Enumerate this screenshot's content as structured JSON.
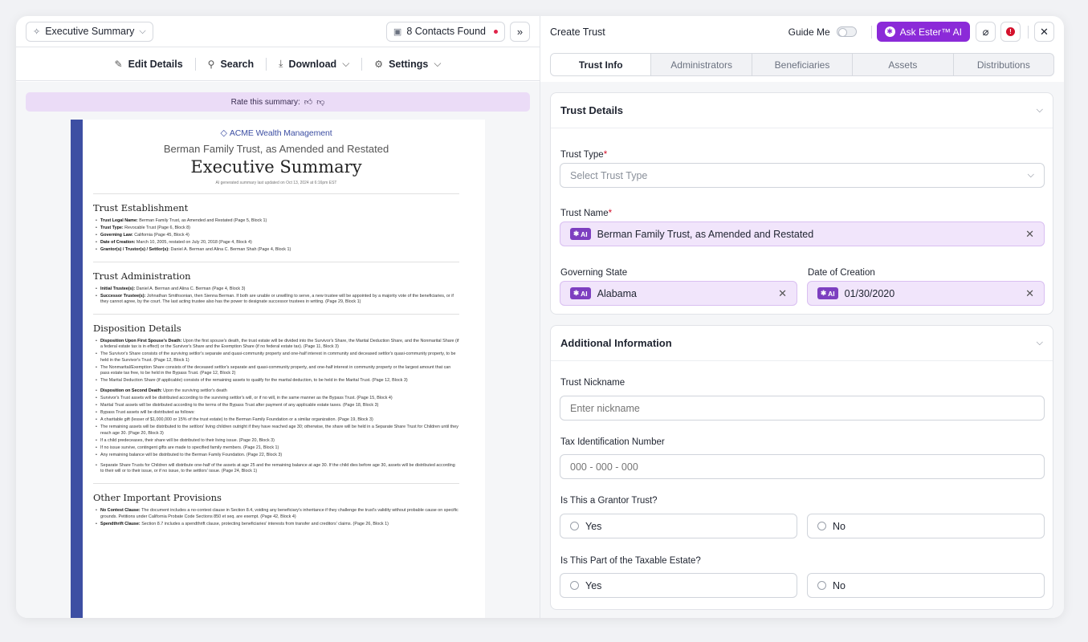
{
  "left": {
    "summary_selector": "Executive Summary",
    "contacts_found": "8 Contacts Found",
    "toolbar": {
      "edit": "Edit Details",
      "search": "Search",
      "download": "Download",
      "settings": "Settings"
    },
    "rate_text": "Rate this summary:",
    "document": {
      "brand": "ACME Wealth Management",
      "subtitle": "Berman Family Trust, as Amended and Restated",
      "title": "Executive Summary",
      "updated": "AI generated summary last updated on Oct 13, 2024 at 6:16pm EST",
      "sections": [
        {
          "heading": "Trust Establishment",
          "bullets": [
            {
              "bold": "Trust Legal Name:",
              "text": " Berman Family Trust, as Amended and Restated (Page 5, Block 1)"
            },
            {
              "bold": "Trust Type:",
              "text": " Revocable Trust (Page 6, Block 8)"
            },
            {
              "bold": "Governing Law:",
              "text": " California (Page 45, Block 4)"
            },
            {
              "bold": "Date of Creation:",
              "text": " March 10, 2005, restated on July 20, 2018 (Page 4, Block 4)"
            },
            {
              "bold": "Grantor(s) / Trustor(s) / Settlor(s):",
              "text": " Daniel A. Berman and Alina C. Berman Shah (Page 4, Block 1)"
            }
          ]
        },
        {
          "heading": "Trust Administration",
          "bullets": [
            {
              "bold": "Initial Trustee(s):",
              "text": " Daniel A. Berman and Alina C. Berman (Page 4, Block 3)"
            },
            {
              "bold": "Successor Trustee(s):",
              "text": " Johnathan Smithsonian, then Sienna Berman. If both are unable or unwilling to serve, a new trustee will be appointed by a majority vote of the beneficiaries, or if they cannot agree, by the court. The last acting trustee also has the power to designate successor trustees in writing. (Page 29, Block 1)"
            }
          ]
        },
        {
          "heading": "Disposition Details",
          "bullets": [
            {
              "bold": "Disposition Upon First Spouse's Death:",
              "text": " Upon the first spouse's death, the trust estate will be divided into the Survivor's Share, the Marital Deduction Share, and the Nonmarital Share (if a federal estate tax is in effect) or the Survivor's Share and the Exemption Share (if no federal estate tax). (Page 11, Block 3)"
            },
            {
              "bold": "",
              "text": "The Survivor's Share consists of the surviving settlor's separate and quasi-community property and one-half interest in community and deceased settlor's quasi-community property, to be held in the Survivor's Trust. (Page 12, Block 1)"
            },
            {
              "bold": "",
              "text": "The Nonmarital/Exemption Share consists of the deceased settlor's separate and quasi-community property, and one-half interest in community property or the largest amount that can pass estate tax free, to be held in the Bypass Trust. (Page 12, Block 2)"
            },
            {
              "bold": "",
              "text": "The Marital Deduction Share (if applicable) consists of the remaining assets to qualify for the marital deduction, to be held in the Marital Trust. (Page 12, Block 3)"
            },
            {
              "bold": "Disposition on Second Death:",
              "text": " Upon the surviving settlor's death",
              "gap": true
            },
            {
              "bold": "",
              "text": "Survivor's Trust assets will be distributed according to the surviving settlor's will, or if no will, in the same manner as the Bypass Trust. (Page 15, Block 4)"
            },
            {
              "bold": "",
              "text": "Marital Trust assets will be distributed according to the terms of the Bypass Trust after payment of any applicable estate taxes. (Page 18, Block 3)"
            },
            {
              "bold": "",
              "text": "Bypass Trust assets will be distributed as follows:"
            },
            {
              "bold": "",
              "text": "A charitable gift (lesser of $1,000,000 or 15% of the trust estate) to the Berman Family Foundation or a similar organization. (Page 19, Block 3)"
            },
            {
              "bold": "",
              "text": "The remaining assets will be distributed to the settlors' living children outright if they have reached age 30; otherwise, the share will be held in a Separate Share Trust for Children until they reach age 30. (Page 20, Block 3)"
            },
            {
              "bold": "",
              "text": "If a child predeceases, their share will be distributed to their living issue. (Page 20, Block 3)"
            },
            {
              "bold": "",
              "text": "If no issue survive, contingent gifts are made to specified family members. (Page 21, Block 1)"
            },
            {
              "bold": "",
              "text": "Any remaining balance will be distributed to the Berman Family Foundation. (Page 22, Block 3)"
            },
            {
              "bold": "",
              "text": "Separate Share Trusts for Children will distribute one-half of the assets at age 25 and the remaining balance at age 30. If the child dies before age 30, assets will be distributed according to their will or to their issue, or if no issue, to the settlors' issue. (Page 24, Block 1)",
              "gap": true
            }
          ]
        },
        {
          "heading": "Other Important Provisions",
          "bullets": [
            {
              "bold": "No Contest Clause:",
              "text": " The document includes a no-contest clause in Section 8.4, voiding any beneficiary's inheritance if they challenge the trust's validity without probable cause on specific grounds. Petitions under California Probate Code Sections 850 et seq. are exempt. (Page 42, Block 4)"
            },
            {
              "bold": "Spendthrift Clause:",
              "text": " Section 8.7 includes a spendthrift clause, protecting beneficiaries' interests from transfer and creditors' claims. (Page 26, Block 1)"
            }
          ]
        }
      ]
    }
  },
  "right": {
    "title": "Create Trust",
    "guide_me": "Guide Me",
    "ask_ester": "Ask Ester™ AI",
    "tabs": [
      "Trust Info",
      "Administrators",
      "Beneficiaries",
      "Assets",
      "Distributions"
    ],
    "trust_details": {
      "heading": "Trust Details",
      "trust_type_label": "Trust Type",
      "trust_type_placeholder": "Select Trust Type",
      "trust_name_label": "Trust Name",
      "trust_name_value": "Berman Family Trust, as Amended and Restated",
      "governing_state_label": "Governing State",
      "governing_state_value": "Alabama",
      "date_label": "Date of Creation",
      "date_value": "01/30/2020",
      "ai_tag": "AI",
      "required_mark": "*"
    },
    "additional": {
      "heading": "Additional Information",
      "nickname_label": "Trust Nickname",
      "nickname_placeholder": "Enter nickname",
      "tin_label": "Tax Identification Number",
      "tin_placeholder": "000 - 000 - 000",
      "grantor_label": "Is This a Grantor Trust?",
      "taxable_label": "Is This Part of the Taxable Estate?",
      "yes": "Yes",
      "no": "No"
    }
  }
}
